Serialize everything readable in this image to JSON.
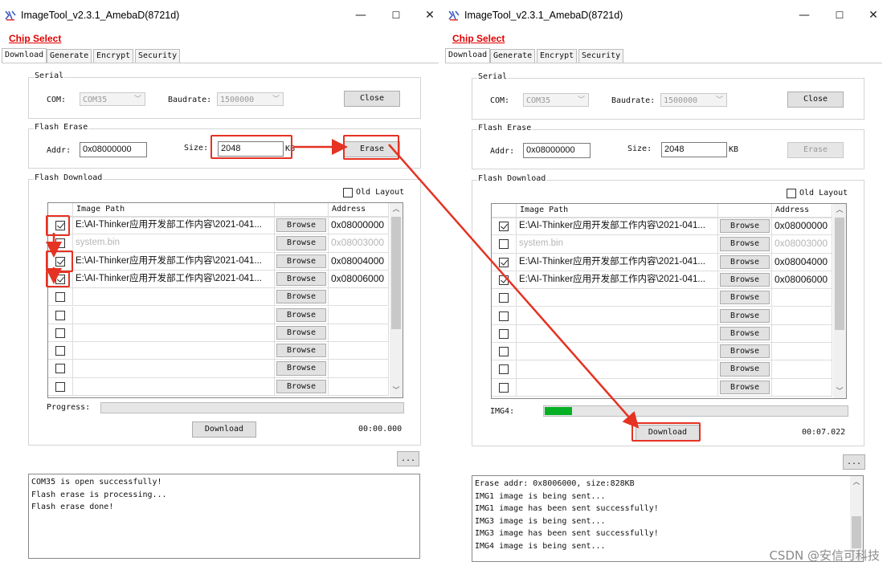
{
  "window": {
    "title": "ImageTool_v2.3.1_AmebaD(8721d)",
    "minimize": "—",
    "maximize": "☐",
    "close": "✕"
  },
  "chip_select": "Chip Select",
  "tabs": [
    "Download",
    "Generate",
    "Encrypt",
    "Security"
  ],
  "serial": {
    "group": "Serial",
    "com_label": "COM:",
    "com_value": "COM35",
    "baud_label": "Baudrate:",
    "baud_value": "1500000",
    "close_button": "Close"
  },
  "flash_erase": {
    "group": "Flash Erase",
    "addr_label": "Addr:",
    "addr_value": "0x08000000",
    "size_label": "Size:",
    "size_value": "2048",
    "size_unit": "KB",
    "erase_button": "Erase"
  },
  "flash_download": {
    "group": "Flash Download",
    "old_layout": "Old Layout",
    "col_path": "Image Path",
    "col_address": "Address",
    "browse": "Browse",
    "rows": [
      {
        "checked": true,
        "path": "E:\\AI-Thinker应用开发部工作内容\\2021-041...",
        "address": "0x08000000",
        "dim": false
      },
      {
        "checked": false,
        "path": "system.bin",
        "address": "0x08003000",
        "dim": true
      },
      {
        "checked": true,
        "path": "E:\\AI-Thinker应用开发部工作内容\\2021-041...",
        "address": "0x08004000",
        "dim": false
      },
      {
        "checked": true,
        "path": "E:\\AI-Thinker应用开发部工作内容\\2021-041...",
        "address": "0x08006000",
        "dim": false
      },
      {
        "checked": false,
        "path": "",
        "address": "",
        "dim": false
      },
      {
        "checked": false,
        "path": "",
        "address": "",
        "dim": false
      },
      {
        "checked": false,
        "path": "",
        "address": "",
        "dim": false
      },
      {
        "checked": false,
        "path": "",
        "address": "",
        "dim": false
      },
      {
        "checked": false,
        "path": "",
        "address": "",
        "dim": false
      },
      {
        "checked": false,
        "path": "",
        "address": "",
        "dim": false
      }
    ]
  },
  "left": {
    "progress_label": "Progress:",
    "progress": 0.0,
    "download_button": "Download",
    "timer": "00:00.000",
    "more_button": "...",
    "log": [
      "COM35 is open successfully!",
      "Flash erase is processing...",
      "Flash erase done!"
    ]
  },
  "right": {
    "progress_label": "IMG4:",
    "progress": 0.09,
    "download_button": "Download",
    "timer": "00:07.022",
    "more_button": "...",
    "log": [
      "Erase addr: 0x8006000, size:828KB",
      "IMG1 image is being sent...",
      "IMG1 image has been sent successfully!",
      "IMG3 image is being sent...",
      "IMG3 image has been sent successfully!",
      "IMG4 image is being sent..."
    ]
  },
  "watermark": "CSDN @安信可科技",
  "colors": {
    "annotation": "#e53222",
    "progress_fill": "#06b025",
    "chip_select": "#e00000"
  }
}
